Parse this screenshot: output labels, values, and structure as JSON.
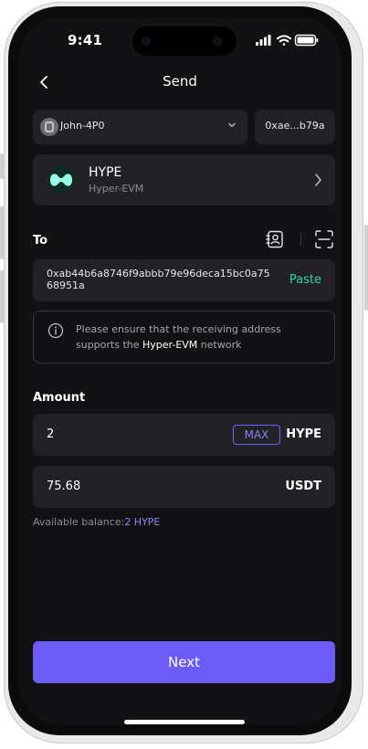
{
  "status_bar": {
    "time": "9:41"
  },
  "header": {
    "title": "Send"
  },
  "account": {
    "name": "John-4P0",
    "address_short": "0xae...b79a"
  },
  "token": {
    "symbol": "HYPE",
    "network": "Hyper-EVM",
    "accent": "#97FCE4"
  },
  "recipient": {
    "label": "To",
    "address": "0xab44b6a8746f9abbb79e96deca15bc0a7568951a",
    "paste_label": "Paste"
  },
  "notice": {
    "prefix": "Please ensure that the receiving address supports the ",
    "network": "Hyper-EVM",
    "suffix": " network"
  },
  "amount": {
    "label": "Amount",
    "value": "2",
    "max_label": "MAX",
    "unit": "HYPE",
    "fiat_value": "75.68",
    "fiat_unit": "USDT"
  },
  "balance": {
    "label": "Available balance:",
    "value": "2 HYPE"
  },
  "footer": {
    "next_label": "Next"
  },
  "colors": {
    "primary": "#6C5CF5",
    "paste": "#2DD4A0",
    "background": "#121214"
  }
}
